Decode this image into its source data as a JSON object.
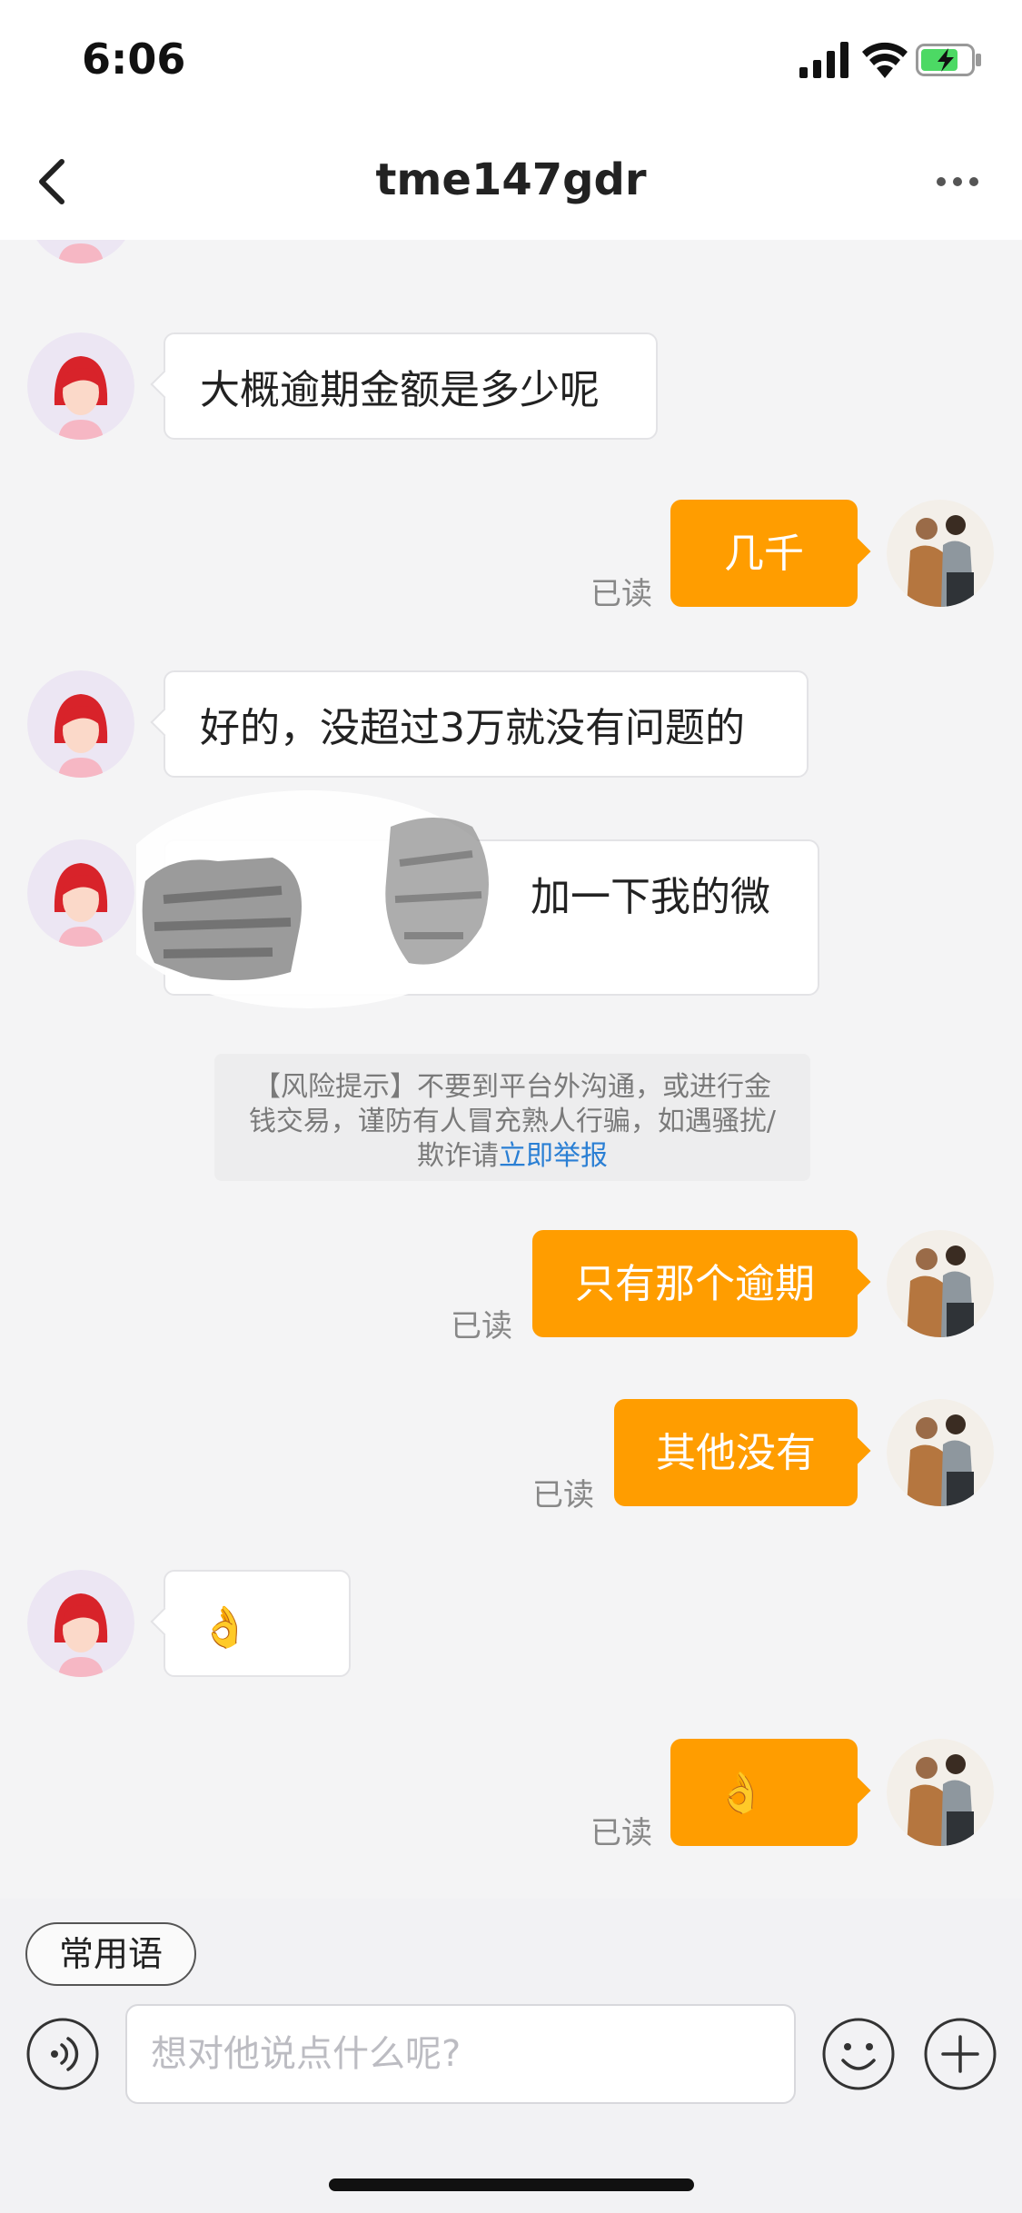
{
  "status_bar": {
    "time": "6:06"
  },
  "header": {
    "title": "tme147gdr"
  },
  "messages": [
    {
      "side": "in",
      "text": "大概逾期金额是多少呢"
    },
    {
      "side": "out",
      "text": "几千",
      "status": "已读"
    },
    {
      "side": "in",
      "text": "好的，没超过3万就没有问题的"
    },
    {
      "side": "in",
      "text": "加一下我的微"
    },
    {
      "side": "out",
      "text": "只有那个逾期",
      "status": "已读"
    },
    {
      "side": "out",
      "text": "其他没有",
      "status": "已读"
    },
    {
      "side": "in",
      "text": "👌"
    },
    {
      "side": "out",
      "text": "👌",
      "status": "已读"
    }
  ],
  "notice": {
    "line1": "【风险提示】不要到平台外沟通，或进行金",
    "line2": "钱交易，谨防有人冒充熟人行骗，如遇骚扰/",
    "line3_prefix": "欺诈请",
    "link": "立即举报"
  },
  "input_bar": {
    "phrase_button": "常用语",
    "placeholder": "想对他说点什么呢?"
  },
  "colors": {
    "accent": "#ff9d00",
    "link": "#2a7fd4",
    "background": "#f4f4f5"
  },
  "icons": [
    "back-arrow-icon",
    "more-icon",
    "voice-icon",
    "emoji-icon",
    "plus-icon"
  ]
}
